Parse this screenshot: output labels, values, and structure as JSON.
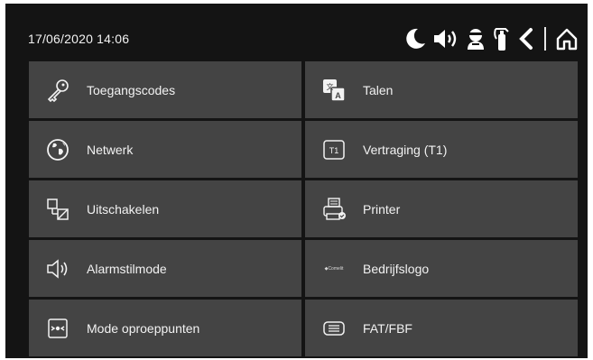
{
  "header": {
    "datetime": "17/06/2020  14:06",
    "status_icons": [
      "moon-icon",
      "speaker-icon",
      "head-icon",
      "extinguisher-icon",
      "back-icon",
      "home-icon"
    ]
  },
  "menu": {
    "left": [
      {
        "label": "Toegangscodes",
        "icon": "key-icon"
      },
      {
        "label": "Netwerk",
        "icon": "globe-icon"
      },
      {
        "label": "Uitschakelen",
        "icon": "disable-icon"
      },
      {
        "label": "Alarmstilmode",
        "icon": "speaker-mute-icon"
      },
      {
        "label": "Mode oproeppunten",
        "icon": "callpoint-icon"
      }
    ],
    "right": [
      {
        "label": "Talen",
        "icon": "translate-icon"
      },
      {
        "label": "Vertraging (T1)",
        "icon": "t1-icon"
      },
      {
        "label": "Printer",
        "icon": "printer-icon"
      },
      {
        "label": "Bedrijfslogo",
        "icon": "company-logo-icon",
        "logo_text": "◆Comelit"
      },
      {
        "label": "FAT/FBF",
        "icon": "fat-fbf-icon"
      }
    ]
  },
  "colors": {
    "background": "#141414",
    "tile": "#444444",
    "text": "#f2f2f2"
  }
}
